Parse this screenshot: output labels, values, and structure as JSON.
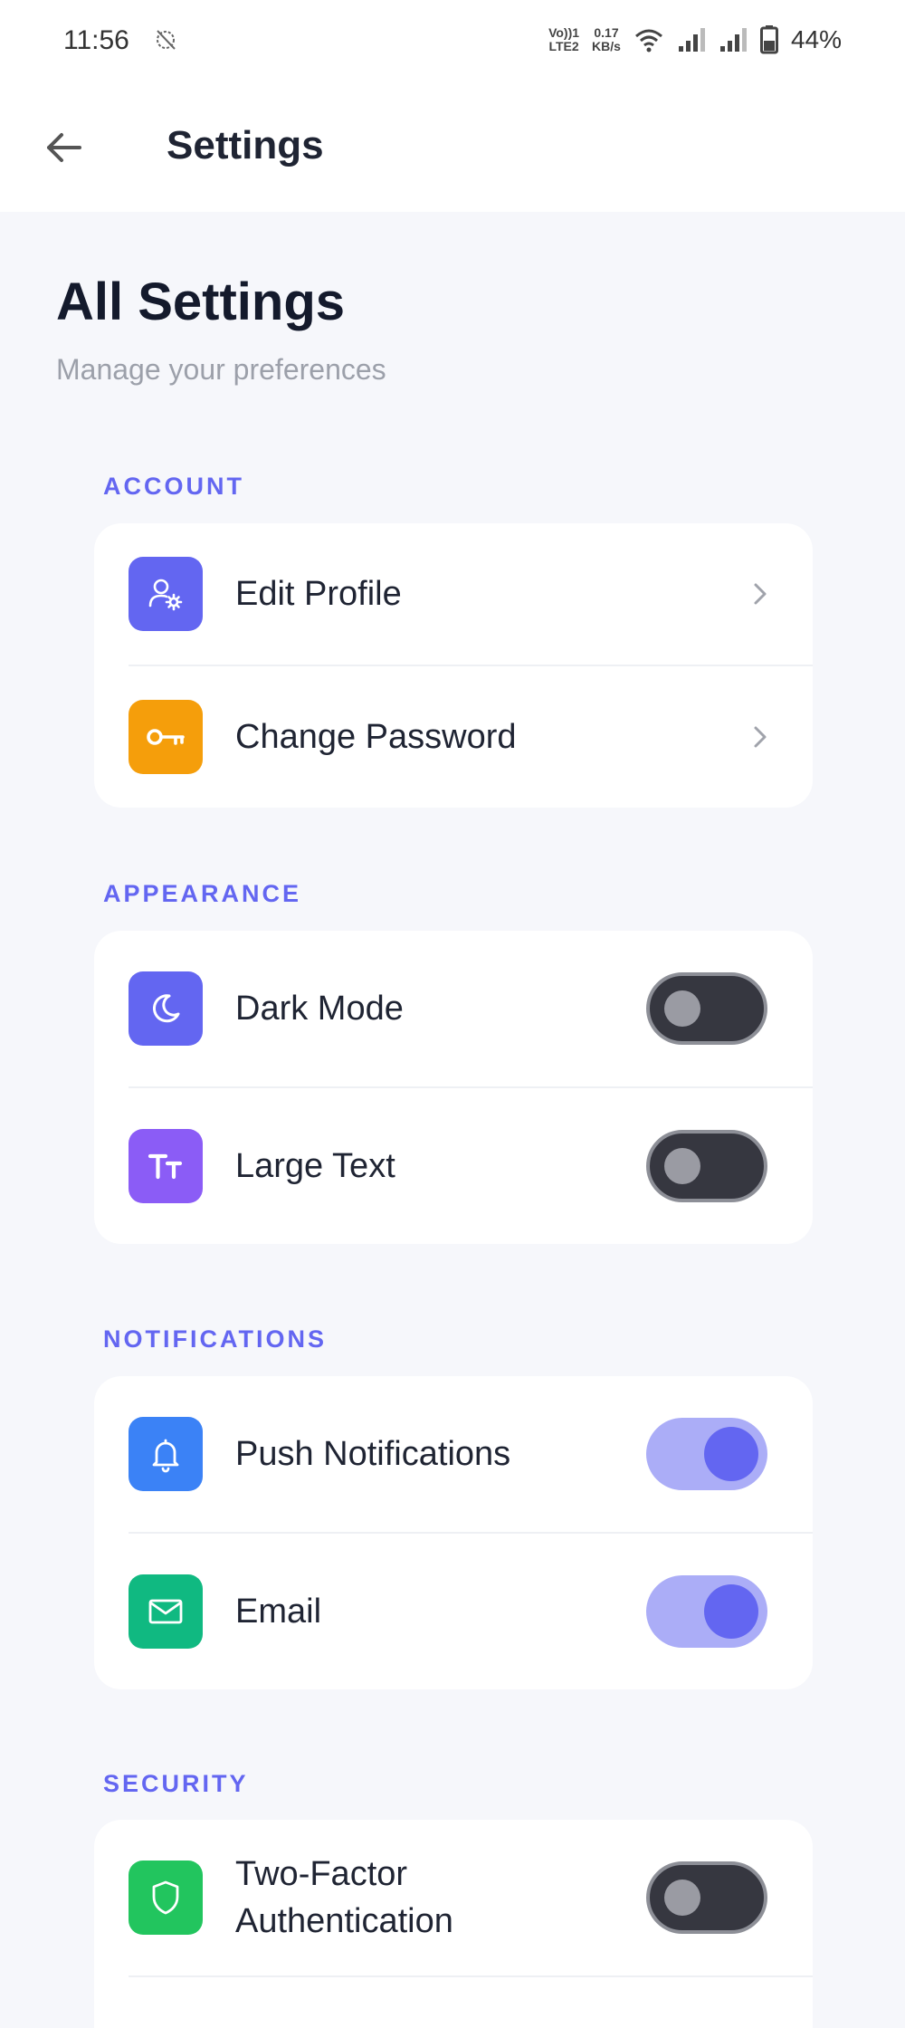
{
  "status": {
    "time": "11:56",
    "net_top": "Vo))1",
    "net_bottom": "LTE2",
    "speed_top": "0.17",
    "speed_bottom": "KB/s",
    "battery": "44%"
  },
  "appbar": {
    "title": "Settings"
  },
  "hero": {
    "title": "All Settings",
    "subtitle": "Manage your preferences"
  },
  "sections": {
    "account": {
      "label": "ACCOUNT",
      "items": [
        {
          "label": "Edit Profile",
          "icon": "user-cog-icon",
          "color": "#6366f1"
        },
        {
          "label": "Change Password",
          "icon": "key-icon",
          "color": "#f59e0b"
        }
      ]
    },
    "appearance": {
      "label": "APPEARANCE",
      "items": [
        {
          "label": "Dark Mode",
          "icon": "moon-icon",
          "color": "#6366f1",
          "enabled": false
        },
        {
          "label": "Large Text",
          "icon": "text-size-icon",
          "color": "#8b5cf6",
          "enabled": false
        }
      ]
    },
    "notifications": {
      "label": "NOTIFICATIONS",
      "items": [
        {
          "label": "Push Notifications",
          "icon": "bell-icon",
          "color": "#3b82f6",
          "enabled": true
        },
        {
          "label": "Email",
          "icon": "mail-icon",
          "color": "#10b981",
          "enabled": true
        }
      ]
    },
    "security": {
      "label": "SECURITY",
      "items": [
        {
          "label": "Two-Factor Authentication",
          "icon": "shield-icon",
          "color": "#22c55e",
          "enabled": false
        }
      ]
    }
  },
  "colors": {
    "accent": "#6366f1",
    "background": "#f6f7fb",
    "toggle_off": "#363740",
    "toggle_on_track": "#abadf7"
  }
}
